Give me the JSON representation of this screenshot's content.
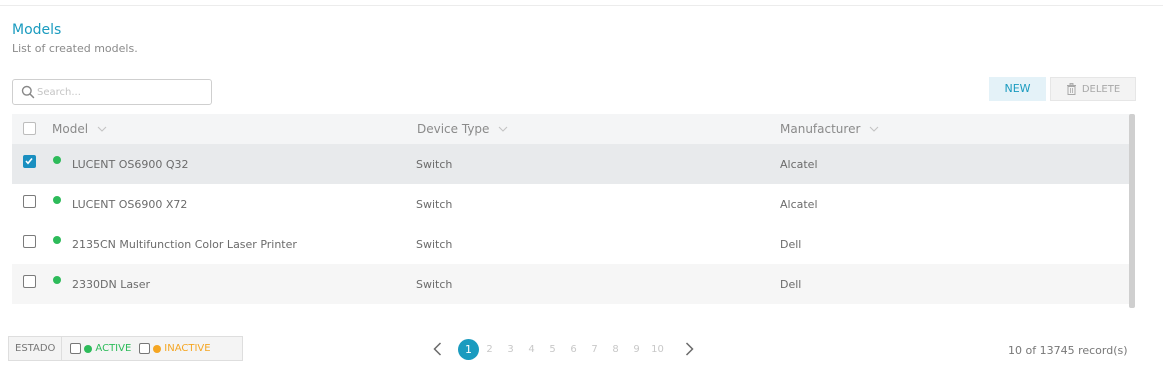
{
  "header": {
    "title": "Models",
    "subtitle": "List of created models."
  },
  "search": {
    "placeholder": "Search..."
  },
  "toolbar": {
    "new_label": "NEW",
    "delete_label": "DELETE"
  },
  "table": {
    "columns": [
      "Model",
      "Device Type",
      "Manufacturer"
    ],
    "rows": [
      {
        "model": "LUCENT OS6900 Q32",
        "device_type": "Switch",
        "manufacturer": "Alcatel",
        "checked": true,
        "status": "active"
      },
      {
        "model": "LUCENT OS6900 X72",
        "device_type": "Switch",
        "manufacturer": "Alcatel",
        "checked": false,
        "status": "active"
      },
      {
        "model": "2135CN Multifunction Color Laser Printer",
        "device_type": "Switch",
        "manufacturer": "Dell",
        "checked": false,
        "status": "active"
      },
      {
        "model": "2330DN Laser",
        "device_type": "Switch",
        "manufacturer": "Dell",
        "checked": false,
        "status": "active"
      }
    ]
  },
  "filter": {
    "label": "ESTADO",
    "active_label": "ACTIVE",
    "inactive_label": "INACTIVE"
  },
  "pagination": {
    "pages": [
      "1",
      "2",
      "3",
      "4",
      "5",
      "6",
      "7",
      "8",
      "9",
      "10"
    ],
    "current": "1"
  },
  "records": {
    "text": "10 of 13745 record(s)"
  },
  "colors": {
    "accent": "#1a9bbf",
    "active": "#2dbb5a",
    "inactive": "#f5a623"
  }
}
